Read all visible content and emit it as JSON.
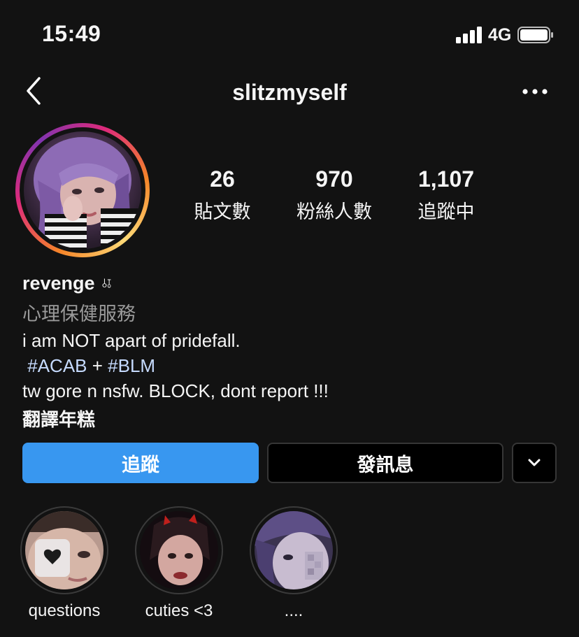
{
  "status_bar": {
    "time": "15:49",
    "network": "4G"
  },
  "nav": {
    "back_icon": "chevron-left-icon",
    "username": "slitzmyself",
    "more_icon": "more-dots-icon"
  },
  "stats": [
    {
      "value": "26",
      "label": "貼文數"
    },
    {
      "value": "970",
      "label": "粉絲人數"
    },
    {
      "value": "1,107",
      "label": "追蹤中"
    }
  ],
  "bio": {
    "name": "revenge",
    "name_symbols": "⫰⫱",
    "category": "心理保健服務",
    "line1": "i am NOT apart of pridefall.",
    "tag_acab": "#ACAB",
    "plus": "+",
    "tag_blm": "#BLM",
    "line3": "tw gore n nsfw. BLOCK, dont report !!!",
    "translate": "翻譯年糕"
  },
  "actions": {
    "follow": "追蹤",
    "message": "發訊息",
    "dropdown_icon": "chevron-down-icon"
  },
  "highlights": [
    {
      "label": "questions"
    },
    {
      "label": "cuties <3"
    },
    {
      "label": "...."
    }
  ],
  "colors": {
    "background": "#121212",
    "follow_button": "#3897f0",
    "hashtag": "#c6dbff",
    "muted_text": "#9a9a9a"
  }
}
